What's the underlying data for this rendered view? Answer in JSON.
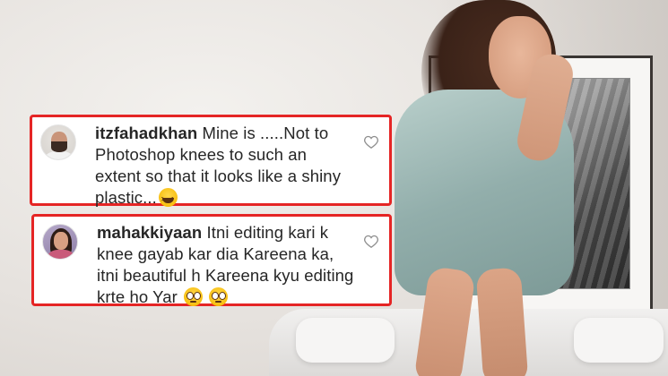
{
  "comments": [
    {
      "username": "itzfahadkhan",
      "text": " Mine is .....Not to Photoshop knees to such an extent so that it looks like a shiny plastic...",
      "emojis": [
        "laughing-face"
      ],
      "like_icon": "heart-outline-icon"
    },
    {
      "username": "mahakkiyaan",
      "text": " Itni editing kari k knee gayab kar dia Kareena ka, itni beautiful h Kareena kyu editing krte ho Yar ",
      "emojis": [
        "rolling-eyes-face",
        "rolling-eyes-face"
      ],
      "like_icon": "heart-outline-icon"
    }
  ],
  "colors": {
    "highlight_border": "#e52525",
    "text": "#262626",
    "icon": "#8e8e8e"
  }
}
